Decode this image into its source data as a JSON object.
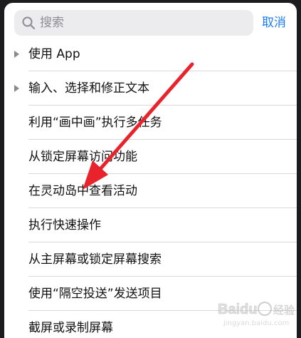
{
  "search": {
    "placeholder": "搜索",
    "cancel_label": "取消"
  },
  "list": {
    "items": [
      {
        "label": "使用 App",
        "expandable": true
      },
      {
        "label": "输入、选择和修正文本",
        "expandable": true
      },
      {
        "label": "利用“画中画”执行多任务",
        "expandable": false
      },
      {
        "label": "从锁定屏幕访问功能",
        "expandable": false
      },
      {
        "label": "在灵动岛中查看活动",
        "expandable": false
      },
      {
        "label": "执行快速操作",
        "expandable": false
      },
      {
        "label": "从主屏幕或锁定屏幕搜索",
        "expandable": false
      },
      {
        "label": "使用“隔空投送”发送项目",
        "expandable": false
      },
      {
        "label": "截屏或录制屏幕",
        "expandable": false
      }
    ]
  },
  "annotation": {
    "arrow_color": "#e8232b"
  },
  "watermark": {
    "brand": "Baidu",
    "suffix": "经验",
    "url": "jingyan.baidu.com"
  }
}
